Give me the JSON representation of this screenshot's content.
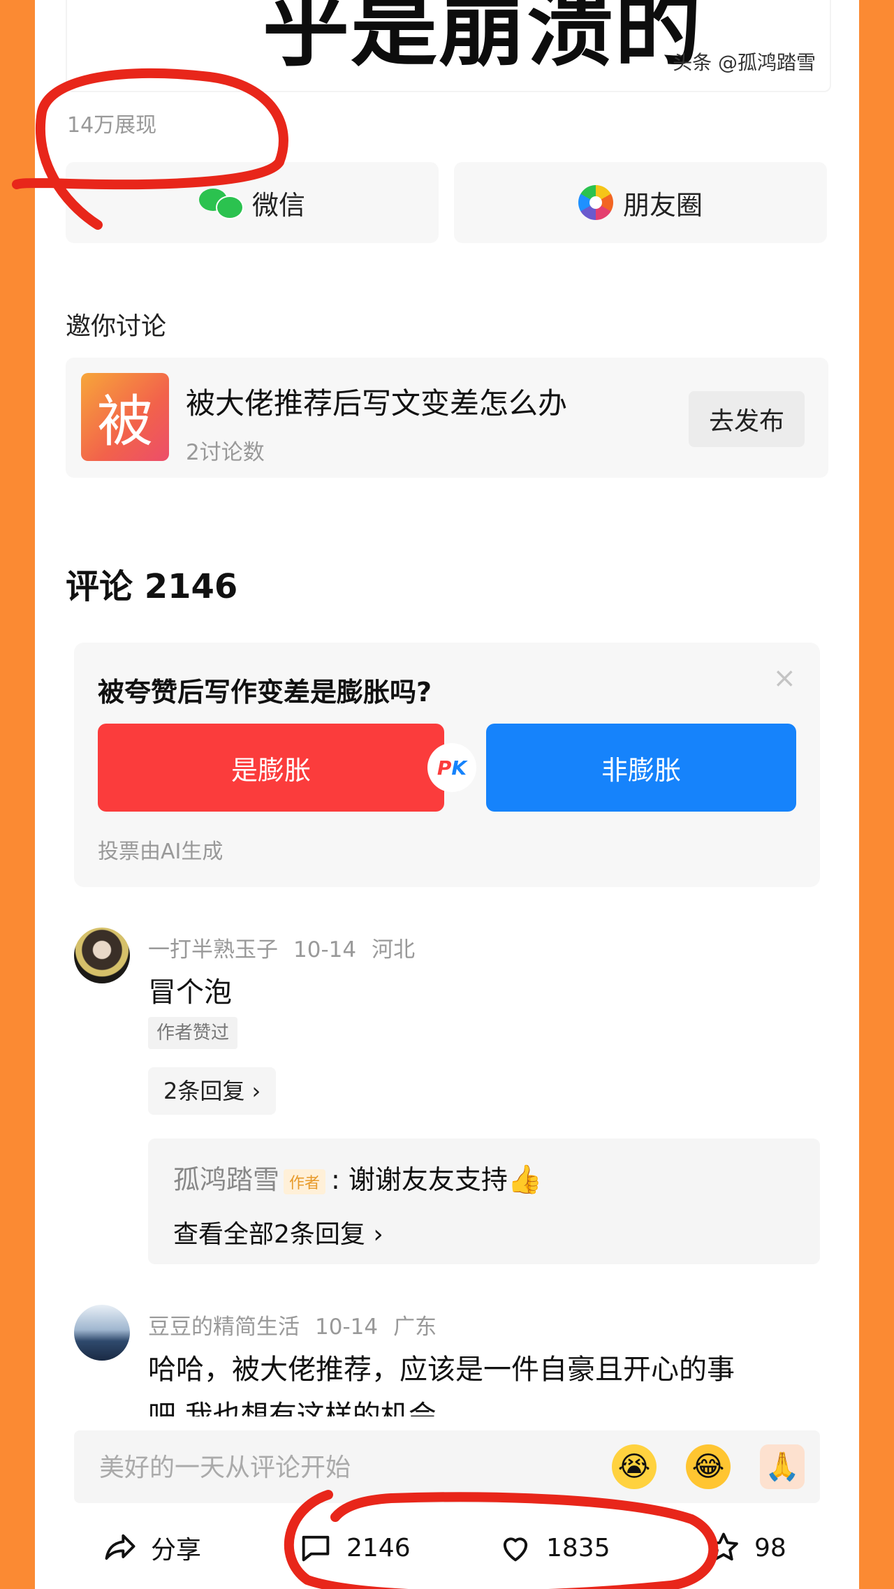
{
  "cover": {
    "title": "乎是崩溃的",
    "watermark": "头条 @孤鸿踏雪"
  },
  "impressions": "14万展现",
  "share": {
    "wechat": "微信",
    "moments": "朋友圈"
  },
  "discussion": {
    "label": "邀你讨论",
    "topic_thumb_char": "被",
    "topic_title": "被大佬推荐后写文变差怎么办",
    "topic_count": "2讨论数",
    "publish_button": "去发布"
  },
  "comments_header": "评论 2146",
  "vote": {
    "question": "被夸赞后写作变差是膨胀吗?",
    "close_symbol": "×",
    "option_yes": "是膨胀",
    "option_no": "非膨胀",
    "pk_p": "P",
    "pk_k": "K",
    "note": "投票由AI生成"
  },
  "comments": [
    {
      "user": "一打半熟玉子",
      "date": "10-14",
      "location": "河北",
      "text": "冒个泡",
      "tag": "作者赞过",
      "replies_button": "2条回复 ›",
      "reply": {
        "author": "孤鸿踏雪",
        "badge": "作者",
        "text": ": 谢谢友友支持",
        "view_all": "查看全部2条回复 ›"
      }
    },
    {
      "user": "豆豆的精简生活",
      "date": "10-14",
      "location": "广东",
      "text_line1": "哈哈，被大佬推荐，应该是一件自豪且开心的事",
      "text_line2": "吧 我也想有这样的机会"
    }
  ],
  "input": {
    "placeholder": "美好的一天从评论开始"
  },
  "actions": {
    "share": "分享",
    "comments": "2146",
    "likes": "1835",
    "favorites": "98"
  },
  "colors": {
    "frame": "#fb8a33",
    "vote_yes": "#fb3c3c",
    "vote_no": "#1683fb",
    "annotation": "#e8261a"
  }
}
